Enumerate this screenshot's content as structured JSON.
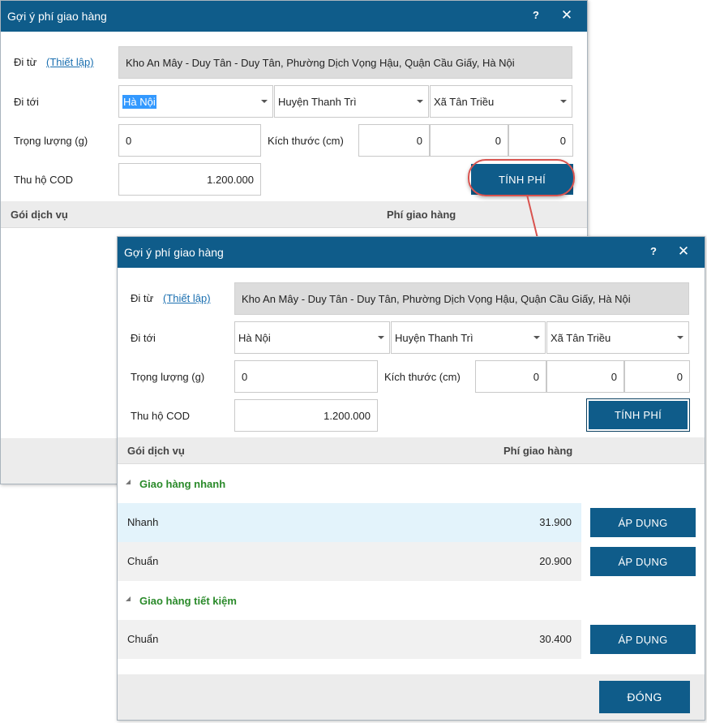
{
  "dialog_title": "Gợi ý phí giao hàng",
  "help_label": "?",
  "close_label": "✕",
  "from_label": "Đi từ",
  "setup_link": "(Thiết lập)",
  "from_address": "Kho An Mây - Duy Tân - Duy Tân, Phường Dịch Vọng Hậu, Quận Cầu Giấy, Hà Nội",
  "to_label": "Đi tới",
  "province": "Hà Nội",
  "district": "Huyện Thanh Trì",
  "ward": "Xã Tân Triều",
  "weight_label": "Trọng lượng (g)",
  "weight_value": "0",
  "size_label": "Kích thước (cm)",
  "size_length": "0",
  "size_width": "0",
  "size_height": "0",
  "cod_label": "Thu hộ COD",
  "cod_value": "1.200.000",
  "calc_button": "TÍNH PHÍ",
  "col_service": "Gói dịch vụ",
  "col_fee": "Phí giao hàng",
  "groups": [
    {
      "name": "Giao hàng nhanh",
      "rows": [
        {
          "service": "Nhanh",
          "fee": "31.900",
          "action": "ÁP DỤNG"
        },
        {
          "service": "Chuẩn",
          "fee": "20.900",
          "action": "ÁP DỤNG"
        }
      ]
    },
    {
      "name": "Giao hàng tiết kiệm",
      "rows": [
        {
          "service": "Chuẩn",
          "fee": "30.400",
          "action": "ÁP DỤNG"
        }
      ]
    }
  ],
  "close_button": "ĐÓNG",
  "colors": {
    "titlebar": "#0f5c8a",
    "button": "#0f5c8a",
    "group_text": "#2a8a2a",
    "highlight_row": "#e3f3fb",
    "callout": "#d9534f"
  }
}
